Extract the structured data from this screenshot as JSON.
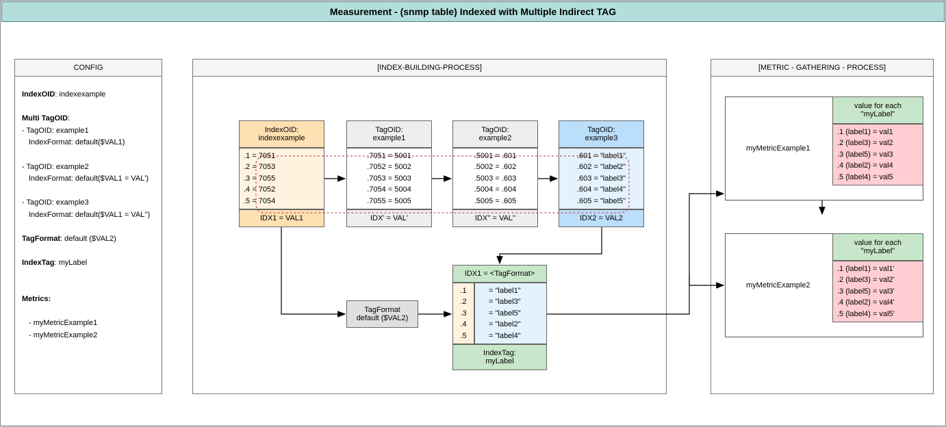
{
  "title": "Measurement - (snmp table) Indexed with Multiple Indirect  TAG",
  "config": {
    "header": "CONFIG",
    "indexOID_label": "IndexOID",
    "indexOID_value": ": indexexample",
    "multiTagOID_label": "Multi TagOID",
    "tag1_line1": "- TagOID: example1",
    "tag1_line2": "IndexFormat: default($VAL1)",
    "tag2_line1": "- TagOID: example2",
    "tag2_line2": "IndexFormat: default($VAL1 = VAL')",
    "tag3_line1": "- TagOID: example3",
    "tag3_line2": "IndexFormat: default($VAL1 = VAL'')",
    "tagFormat_label": "TagFormat",
    "tagFormat_value": ": default ($VAL2)",
    "indexTag_label": "IndexTag",
    "indexTag_value": ": myLabel",
    "metrics_label": "Metrics:",
    "metric1": "- myMetricExample1",
    "metric2": "- myMetricExample2"
  },
  "ibp": {
    "header": "[INDEX-BUILDING-PROCESS]",
    "col1": {
      "header": "IndexOID:\nindexexample",
      "rows": ".1 = 7051\n.2 = 7053\n.3 = 7055\n.4 = 7052\n.5 = 7054",
      "footer": "IDX1 = VAL1"
    },
    "col2": {
      "header": "TagOID:\nexample1",
      "rows": ".7051 = 5001\n.7052 = 5002\n.7053 = 5003\n.7054 = 5004\n.7055 = 5005",
      "footer": "IDX' = VAL'"
    },
    "col3": {
      "header": "TagOID:\nexample2",
      "rows": ".5001 = .601\n.5002 = .602\n.5003 = .603\n.5004 = .604\n.5005 = .605",
      "footer": "IDX'' = VAL''"
    },
    "col4": {
      "header": "TagOID:\nexample3",
      "rows": ".601 = \"label1\"\n.602 = \"label2\"\n.603 = \"label3\"\n.604 = \"label4\"\n.605 = \"label5\"",
      "footer": "IDX2 = VAL2"
    },
    "tagformat": "TagFormat\ndefault ($VAL2)",
    "result": {
      "header": "IDX1 = <TagFormat>",
      "idx": ".1\n.2\n.3\n.4\n.5",
      "vals": "= \"label1\"\n= \"label3\"\n= \"label5\"\n= \"label2\"\n= \"label4\"",
      "footer": "IndexTag:\nmyLabel"
    }
  },
  "mgp": {
    "header": "[METRIC - GATHERING - PROCESS]",
    "metric1": {
      "name": "myMetricExample1",
      "sub": "value for each\n\"myLabel\"",
      "rows": ".1 (label1) = val1\n.2 (label3) = val2\n.3 (label5) = val3\n.4 (label2) = val4\n.5 (label4) = val5"
    },
    "metric2": {
      "name": "myMetricExample2",
      "sub": "value for each\n\"myLabel\"",
      "rows": ".1 (label1) = val1'\n.2 (label3) = val2'\n.3 (label5) = val3'\n.4 (label2) = val4'\n.5 (label4) = val5'"
    }
  }
}
